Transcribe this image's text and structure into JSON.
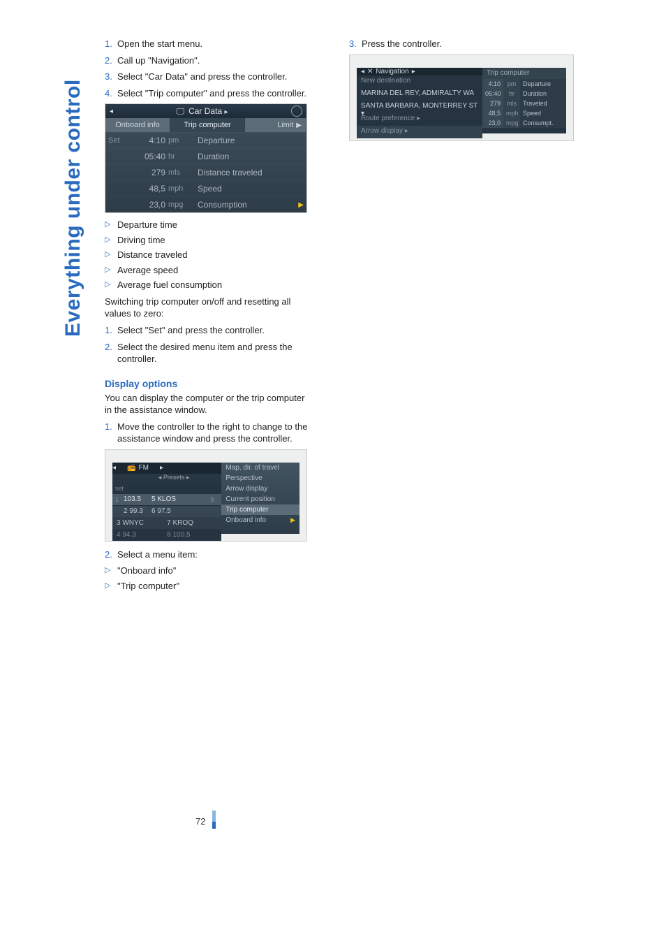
{
  "sideTitle": "Everything under control",
  "pageNumber": "72",
  "left": {
    "steps1": [
      "Open the start menu.",
      "Call up \"Navigation\".",
      "Select \"Car Data\" and press the controller.",
      "Select \"Trip computer\" and press the controller."
    ],
    "bullets": [
      "Departure time",
      "Driving time",
      "Distance traveled",
      "Average speed",
      "Average fuel consumption"
    ],
    "switching": "Switching trip computer on/off and resetting all values to zero:",
    "steps2": [
      "Select \"Set\" and press the controller.",
      "Select the desired menu item and press the controller."
    ],
    "h2": "Display options",
    "displayText": "You can display the computer or the trip computer in the assistance window.",
    "steps3": [
      "Move the controller to the right to change to the assistance window and press the controller."
    ],
    "steps4": [
      "Select a menu item:"
    ],
    "subBullets": [
      "\"Onboard info\"",
      "\"Trip computer\""
    ]
  },
  "right": {
    "step": "Press the controller."
  },
  "carDataShot": {
    "title": "Car Data",
    "tabs": {
      "onboard": "Onboard info",
      "trip": "Trip computer",
      "limit": "Limit"
    },
    "rows": [
      {
        "set": "Set",
        "val": "4:10",
        "unit": "pm",
        "lbl": "Departure",
        "play": ""
      },
      {
        "set": "",
        "val": "05:40",
        "unit": "hr",
        "lbl": "Duration",
        "play": ""
      },
      {
        "set": "",
        "val": "279",
        "unit": "mls",
        "lbl": "Distance traveled",
        "play": ""
      },
      {
        "set": "",
        "val": "48,5",
        "unit": "mph",
        "lbl": "Speed",
        "play": ""
      },
      {
        "set": "",
        "val": "23,0",
        "unit": "mpg",
        "lbl": "Consumption",
        "play": "▶"
      }
    ]
  },
  "fmShot": {
    "bar": {
      "l": "◂",
      "c": "FM",
      "r": "▸"
    },
    "presets": "◂ Presets ▸",
    "set": "set",
    "rows": [
      {
        "n": "1",
        "a": "103.5",
        "b": "5 KLOS",
        "end": "9"
      },
      {
        "n": "",
        "a": "2 99.3",
        "b": "6 97.5",
        "end": ""
      }
    ],
    "row3": {
      "a": "3 WNYC",
      "b": "7 KROQ"
    },
    "row4": {
      "a": "4 94.3",
      "b": "8 100.5"
    },
    "rightItems": [
      "Map, dir. of travel",
      "Perspective",
      "Arrow display",
      "Current position",
      "Trip computer",
      "Onboard info"
    ]
  },
  "navShot": {
    "bar": {
      "l": "◂",
      "icon": "✕",
      "title": "Navigation",
      "r": "▸"
    },
    "leftItems": [
      {
        "t": "New destination",
        "dim": true
      },
      {
        "t": "MARINA DEL REY, ADMIRALTY WA"
      },
      {
        "t": "SANTA BARBARA, MONTERREY ST",
        "arrow": "▾"
      },
      {
        "t": "Route preference ▸",
        "dim": true
      },
      {
        "t": "Arrow display ▸",
        "dim": true,
        "hi": true
      }
    ],
    "rightHeader": "Trip computer",
    "rightRows": [
      {
        "v": "4:10",
        "u": "pm",
        "l": "Departure"
      },
      {
        "v": "05:40",
        "u": "hr",
        "l": "Duration"
      },
      {
        "v": "279",
        "u": "mls",
        "l": "Traveled"
      },
      {
        "v": "48,5",
        "u": "mph",
        "l": "Speed"
      },
      {
        "v": "23,0",
        "u": "mpg",
        "l": "Consumpt."
      }
    ]
  }
}
